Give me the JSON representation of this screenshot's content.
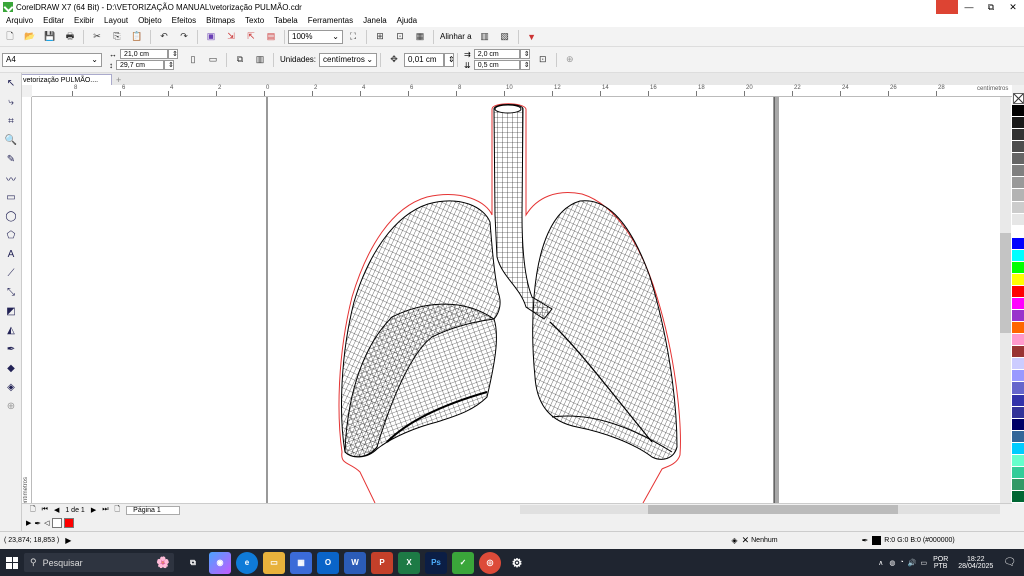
{
  "window": {
    "title": "CorelDRAW X7 (64 Bit) - D:\\VETORIZAÇÃO MANUAL\\vetorização PULMÃO.cdr",
    "minimize": "—",
    "restore": "⧉",
    "close": "✕"
  },
  "menu": [
    "Arquivo",
    "Editar",
    "Exibir",
    "Layout",
    "Objeto",
    "Efeitos",
    "Bitmaps",
    "Texto",
    "Tabela",
    "Ferramentas",
    "Janela",
    "Ajuda"
  ],
  "toolbar1": {
    "zoom": "100%",
    "align_label": "Alinhar a"
  },
  "toolbar2": {
    "page_size": "A4",
    "width": "21,0 cm",
    "height": "29,7 cm",
    "units_label": "Unidades:",
    "units_value": "centímetros",
    "nudge": "0,01 cm",
    "dup_x": "2,0 cm",
    "dup_y": "0,5 cm"
  },
  "doc_tab": "vetorização PULMÃO....",
  "ruler": {
    "unit_label": "centímetros",
    "h_ticks": [
      "8",
      "6",
      "4",
      "2",
      "0",
      "2",
      "4",
      "6",
      "8",
      "10",
      "12",
      "14",
      "16",
      "18",
      "20",
      "22",
      "24",
      "26",
      "28"
    ],
    "v_unit": "centímetros"
  },
  "page_nav": {
    "page_count": "1 de 1",
    "page_tab": "Página 1"
  },
  "status": {
    "coords": "( 23,874; 18,853 )",
    "fill_none": "Nenhum",
    "outline_color": "R:0 G:0 B:0 (#000000)"
  },
  "palette": [
    "#000000",
    "#1a1a1a",
    "#333333",
    "#4d4d4d",
    "#666666",
    "#808080",
    "#999999",
    "#b3b3b3",
    "#cccccc",
    "#e6e6e6",
    "#ffffff",
    "#0000ff",
    "#00ffff",
    "#00ff00",
    "#ffff00",
    "#ff0000",
    "#ff00ff",
    "#9933cc",
    "#ff6600",
    "#ff99cc",
    "#993333",
    "#ccccff",
    "#9999ff",
    "#6666cc",
    "#3333aa",
    "#333399",
    "#000066",
    "#336699",
    "#00ccff",
    "#66ffcc",
    "#33cc99",
    "#339966",
    "#006633"
  ],
  "taskbar": {
    "search_placeholder": "Pesquisar",
    "lang1": "POR",
    "lang2": "PTB",
    "time": "18:22",
    "date": "28/04/2025"
  }
}
